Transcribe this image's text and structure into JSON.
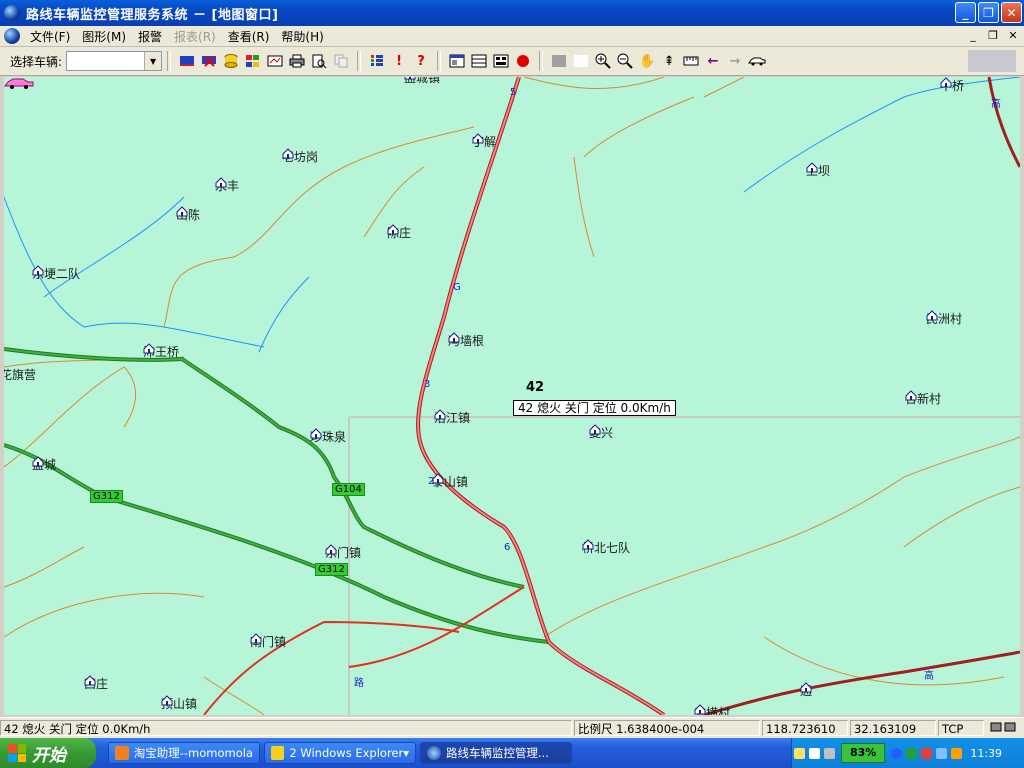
{
  "window": {
    "title": "路线车辆监控管理服务系统 － [地图窗口]"
  },
  "menu": {
    "items": [
      {
        "label": "文件(F)",
        "enabled": true
      },
      {
        "label": "图形(M)",
        "enabled": true
      },
      {
        "label": "报警",
        "enabled": true
      },
      {
        "label": "报表(R)",
        "enabled": false
      },
      {
        "label": "查看(R)",
        "enabled": true
      },
      {
        "label": "帮助(H)",
        "enabled": true
      }
    ]
  },
  "toolbar": {
    "vehicle_label": "选择车辆:",
    "vehicle_value": ""
  },
  "map": {
    "places": [
      {
        "name": "盐城镇"
      },
      {
        "name": "丁解"
      },
      {
        "name": "中桥"
      },
      {
        "name": "老坊岗"
      },
      {
        "name": "上坝"
      },
      {
        "name": "永丰"
      },
      {
        "name": "山陈"
      },
      {
        "name": "陈庄"
      },
      {
        "name": "东埂二队"
      },
      {
        "name": "民洲村"
      },
      {
        "name": "冯墙根"
      },
      {
        "name": "沛王桥"
      },
      {
        "name": "花旗营"
      },
      {
        "name": "合新村"
      },
      {
        "name": "沿江镇"
      },
      {
        "name": "珍珠泉"
      },
      {
        "name": "复兴"
      },
      {
        "name": "盘城"
      },
      {
        "name": "泰山镇"
      },
      {
        "name": "桥北七队"
      },
      {
        "name": "东门镇"
      },
      {
        "name": "南门镇"
      },
      {
        "name": "西庄"
      },
      {
        "name": "顶山镇"
      },
      {
        "name": "五横村"
      },
      {
        "name": "通"
      }
    ],
    "road_badges": [
      "G312",
      "G104",
      "G312"
    ],
    "road_numbers": [
      "5",
      "G",
      "3",
      "2",
      "6",
      "路",
      "高",
      "高"
    ],
    "vehicle": {
      "id": "42",
      "info": "42 熄火 关门 定位  0.0Km/h"
    }
  },
  "status": {
    "vehicle_status": "42 熄火 关门 定位  0.0Km/h",
    "scale": "比例尺 1.638400e-004",
    "longitude": "118.723610",
    "latitude": "32.163109",
    "protocol": "TCP"
  },
  "taskbar": {
    "start_label": "开始",
    "tasks": [
      "淘宝助理--momomola",
      "2 Windows Explorer",
      "路线车辆监控管理..."
    ],
    "battery": "83%",
    "clock": "11:39"
  },
  "colors": {
    "map_bg": "#b7f5d9",
    "national_road": "#2e8b2e",
    "highway": "#d03030",
    "river": "#1e90ff",
    "minor_road": "#d88a30"
  }
}
